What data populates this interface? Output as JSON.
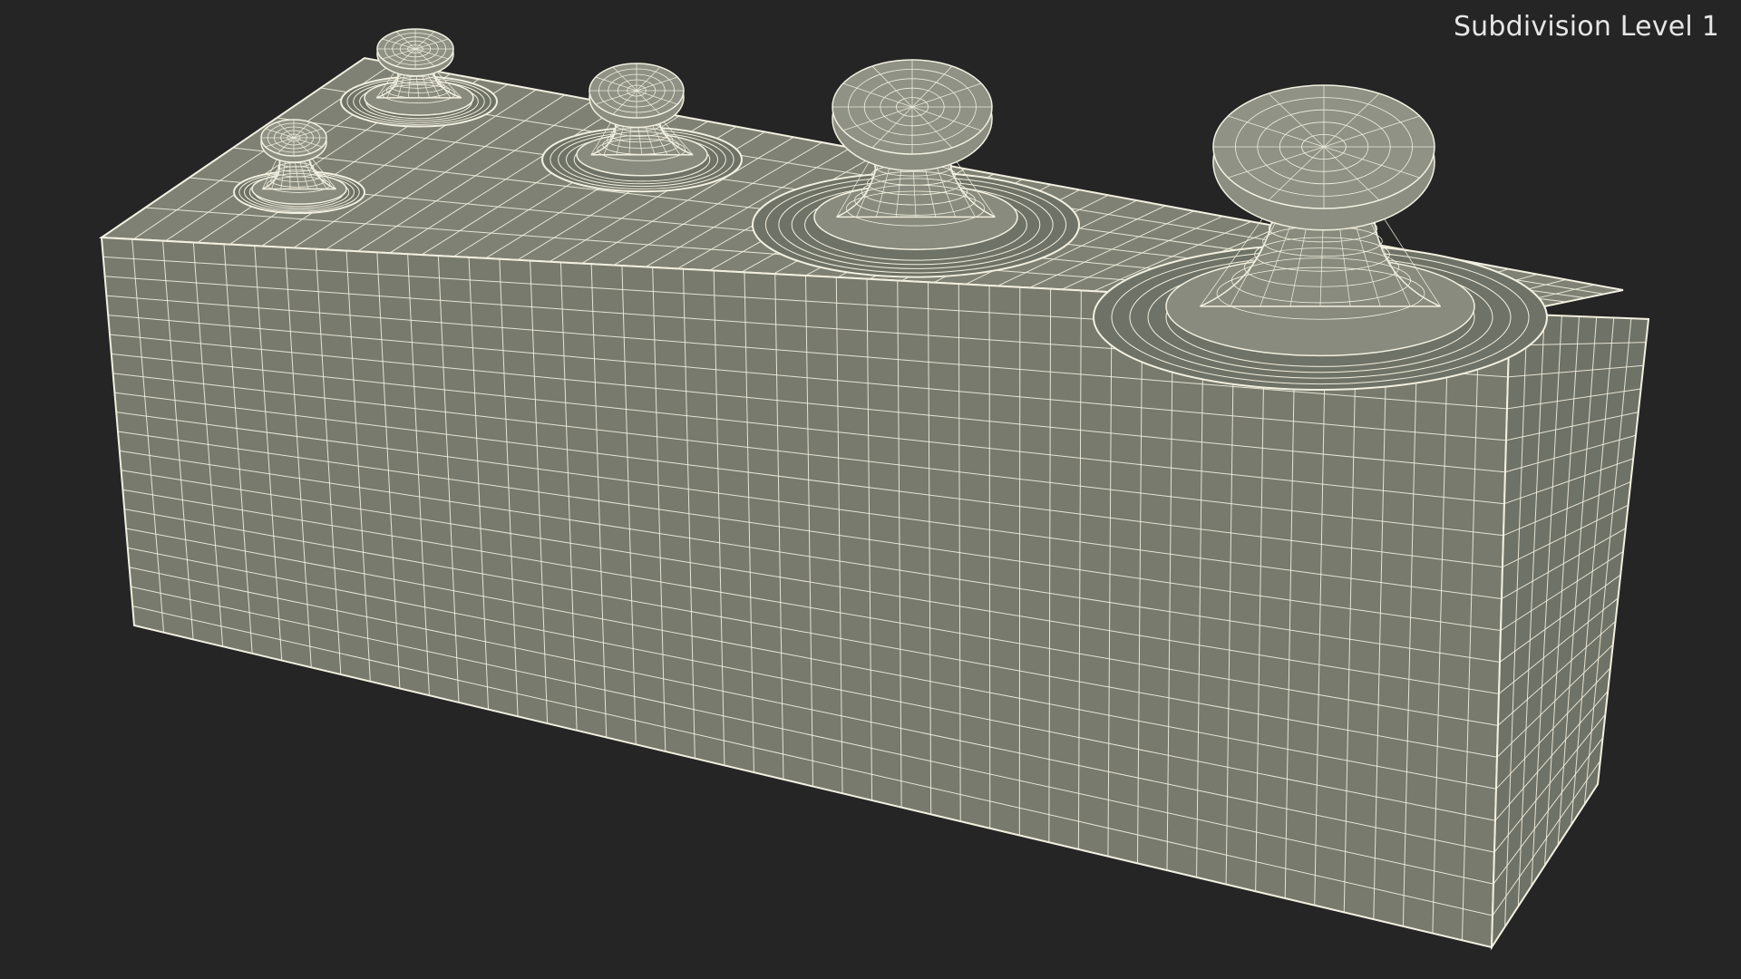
{
  "viewport": {
    "label": "Subdivision Level 1",
    "subject": "weights-set-wireframe",
    "colors": {
      "background": "#252525",
      "mesh_fill_front": "#777a6d",
      "mesh_fill_top": "#7e8174",
      "mesh_fill_right": "#6f7266",
      "wire": "#f2f0e0"
    }
  }
}
